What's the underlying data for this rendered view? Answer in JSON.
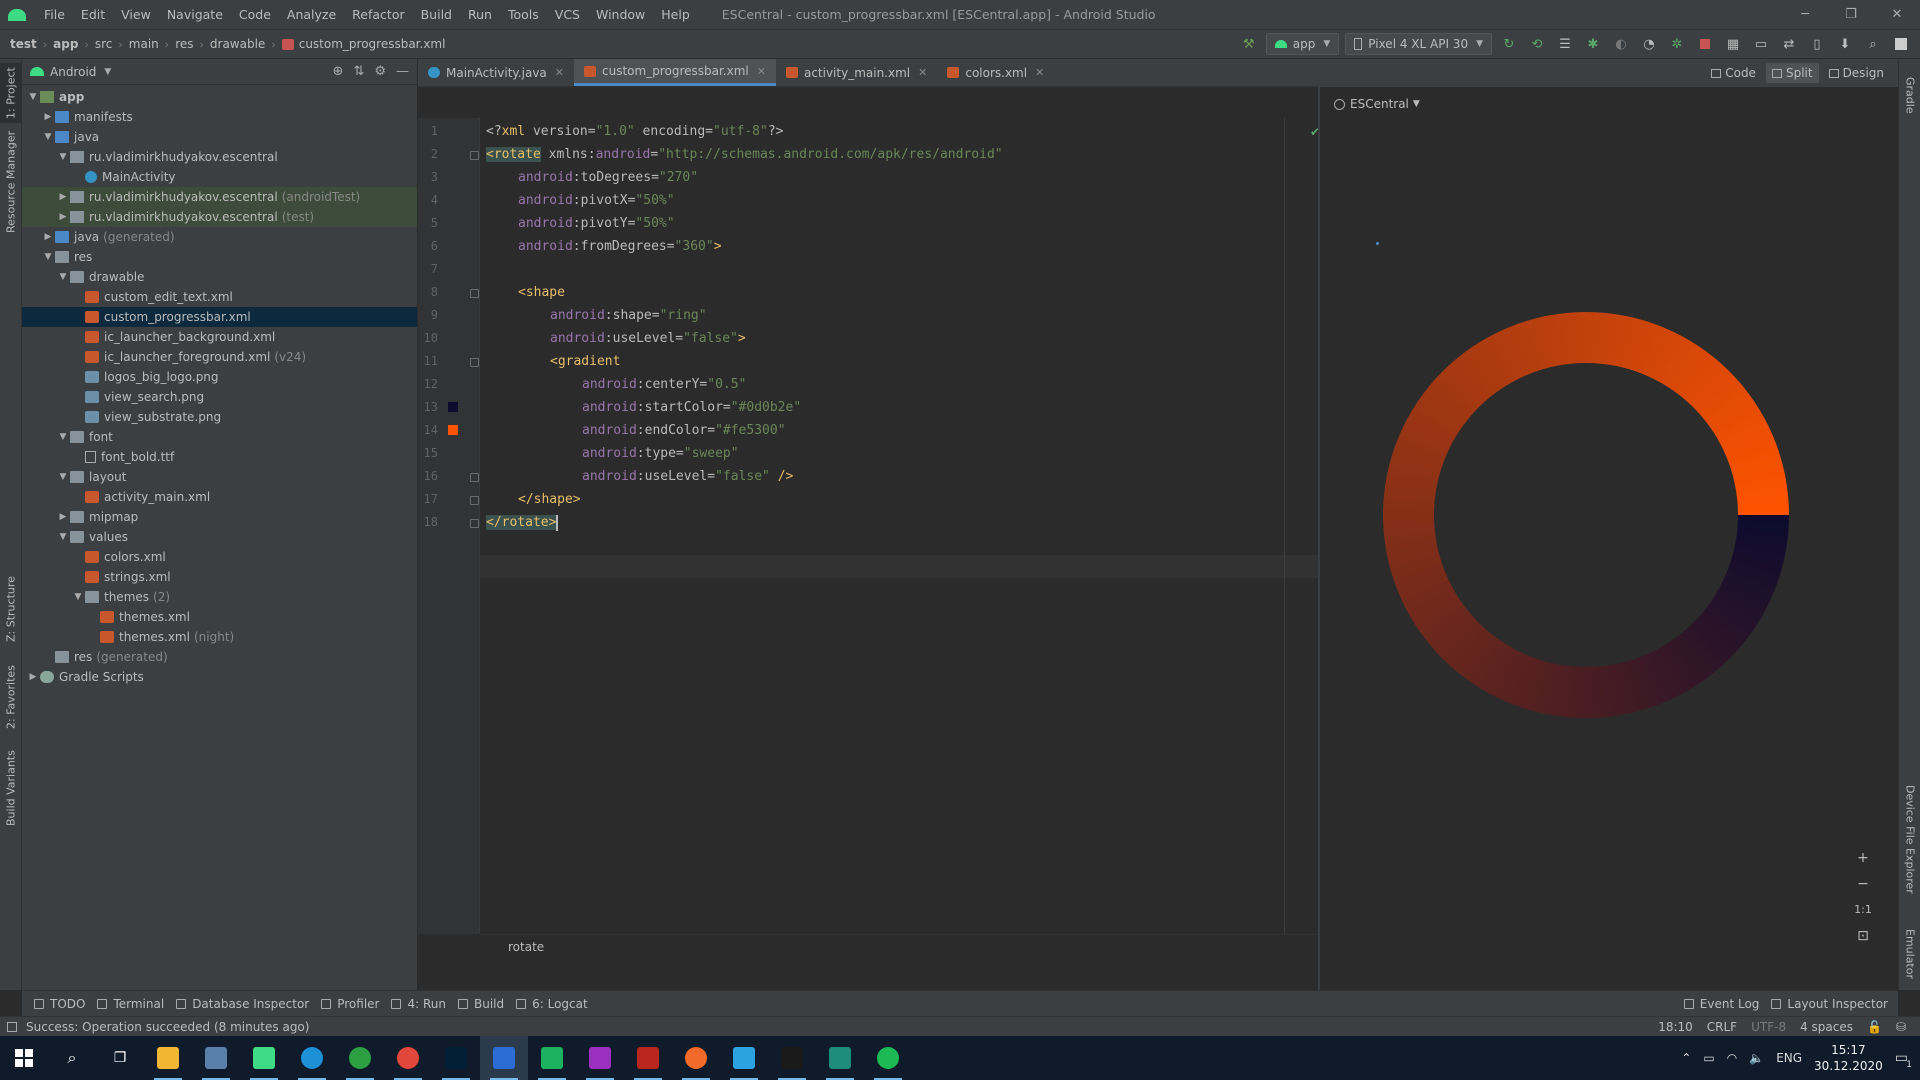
{
  "window": {
    "title": "ESCentral - custom_progressbar.xml [ESCentral.app] - Android Studio",
    "menu": [
      "File",
      "Edit",
      "View",
      "Navigate",
      "Code",
      "Analyze",
      "Refactor",
      "Build",
      "Run",
      "Tools",
      "VCS",
      "Window",
      "Help"
    ]
  },
  "breadcrumbs": [
    "test",
    "app",
    "src",
    "main",
    "res",
    "drawable",
    "custom_progressbar.xml"
  ],
  "toolbar": {
    "config": "app",
    "device": "Pixel 4 XL API 30"
  },
  "left_strip": {
    "project": "1: Project",
    "resource_manager": "Resource Manager",
    "structure": "Z: Structure",
    "favorites": "2: Favorites",
    "build_variants": "Build Variants"
  },
  "right_strip": {
    "gradle": "Gradle",
    "device_file_explorer": "Device File Explorer",
    "emulator": "Emulator"
  },
  "project_panel": {
    "view": "Android",
    "tree": [
      {
        "label": "app",
        "depth": 0,
        "icon": "app",
        "open": true,
        "bold": true
      },
      {
        "label": "manifests",
        "depth": 1,
        "icon": "folderb",
        "open": false
      },
      {
        "label": "java",
        "depth": 1,
        "icon": "folderb",
        "open": true
      },
      {
        "label": "ru.vladimirkhudyakov.escentral",
        "depth": 2,
        "icon": "pkg",
        "open": true
      },
      {
        "label": "MainActivity",
        "depth": 3,
        "icon": "cls"
      },
      {
        "label": "ru.vladimirkhudyakov.escentral",
        "sub": "(androidTest)",
        "depth": 2,
        "icon": "pkg",
        "open": false,
        "hl": true
      },
      {
        "label": "ru.vladimirkhudyakov.escentral",
        "sub": "(test)",
        "depth": 2,
        "icon": "pkg",
        "open": false,
        "hl": true
      },
      {
        "label": "java",
        "sub": "(generated)",
        "depth": 1,
        "icon": "folderb",
        "open": false
      },
      {
        "label": "res",
        "depth": 1,
        "icon": "folder",
        "open": true
      },
      {
        "label": "drawable",
        "depth": 2,
        "icon": "folder",
        "open": true
      },
      {
        "label": "custom_edit_text.xml",
        "depth": 3,
        "icon": "xml"
      },
      {
        "label": "custom_progressbar.xml",
        "depth": 3,
        "icon": "xml",
        "sel": true
      },
      {
        "label": "ic_launcher_background.xml",
        "depth": 3,
        "icon": "xml"
      },
      {
        "label": "ic_launcher_foreground.xml",
        "sub": "(v24)",
        "depth": 3,
        "icon": "xml"
      },
      {
        "label": "logos_big_logo.png",
        "depth": 3,
        "icon": "png"
      },
      {
        "label": "view_search.png",
        "depth": 3,
        "icon": "png"
      },
      {
        "label": "view_substrate.png",
        "depth": 3,
        "icon": "png"
      },
      {
        "label": "font",
        "depth": 2,
        "icon": "folder",
        "open": true
      },
      {
        "label": "font_bold.ttf",
        "depth": 3,
        "icon": "ttf"
      },
      {
        "label": "layout",
        "depth": 2,
        "icon": "folder",
        "open": true
      },
      {
        "label": "activity_main.xml",
        "depth": 3,
        "icon": "xml"
      },
      {
        "label": "mipmap",
        "depth": 2,
        "icon": "folder",
        "open": false
      },
      {
        "label": "values",
        "depth": 2,
        "icon": "folder",
        "open": true
      },
      {
        "label": "colors.xml",
        "depth": 3,
        "icon": "xml"
      },
      {
        "label": "strings.xml",
        "depth": 3,
        "icon": "xml"
      },
      {
        "label": "themes",
        "sub": "(2)",
        "depth": 3,
        "icon": "folder",
        "open": true
      },
      {
        "label": "themes.xml",
        "depth": 4,
        "icon": "xml"
      },
      {
        "label": "themes.xml",
        "sub": "(night)",
        "depth": 4,
        "icon": "xml"
      },
      {
        "label": "res",
        "sub": "(generated)",
        "depth": 1,
        "icon": "folder"
      },
      {
        "label": "Gradle Scripts",
        "depth": 0,
        "icon": "gradle",
        "open": false
      }
    ]
  },
  "editor": {
    "tabs": [
      {
        "label": "MainActivity.java",
        "icon_color": "#3592c4",
        "active": false
      },
      {
        "label": "custom_progressbar.xml",
        "icon_color": "#c9572e",
        "active": true
      },
      {
        "label": "activity_main.xml",
        "icon_color": "#c9572e",
        "active": false
      },
      {
        "label": "colors.xml",
        "icon_color": "#c9572e",
        "active": false
      }
    ],
    "line_numbers": [
      "1",
      "2",
      "3",
      "4",
      "5",
      "6",
      "7",
      "8",
      "9",
      "10",
      "11",
      "12",
      "13",
      "14",
      "15",
      "16",
      "17",
      "18"
    ],
    "breadcrumb": "rotate",
    "color_marks": [
      "#0d0b2e",
      "#fe5300"
    ]
  },
  "code": {
    "l1": {
      "a": "<?",
      "b": "xml ",
      "c": "version=",
      "d": "\"1.0\"",
      "e": " encoding=",
      "f": "\"utf-8\"",
      "g": "?>"
    },
    "l2": {
      "a": "<rotate",
      "b": " xmlns:",
      "c": "android",
      "d": "=",
      "e": "\"http://schemas.android.com/apk/res/android\""
    },
    "l3": {
      "ns": "android",
      "at": ":toDegrees=",
      "av": "\"270\""
    },
    "l4": {
      "ns": "android",
      "at": ":pivotX=",
      "av": "\"50%\""
    },
    "l5": {
      "ns": "android",
      "at": ":pivotY=",
      "av": "\"50%\""
    },
    "l6": {
      "ns": "android",
      "at": ":fromDegrees=",
      "av": "\"360\"",
      "end": ">"
    },
    "l8": {
      "tg": "<shape"
    },
    "l9": {
      "ns": "android",
      "at": ":shape=",
      "av": "\"ring\""
    },
    "l10": {
      "ns": "android",
      "at": ":useLevel=",
      "av": "\"false\"",
      "end": ">"
    },
    "l11": {
      "tg": "<gradient"
    },
    "l12": {
      "ns": "android",
      "at": ":centerY=",
      "av": "\"0.5\""
    },
    "l13": {
      "ns": "android",
      "at": ":startColor=",
      "av": "\"#0d0b2e\""
    },
    "l14": {
      "ns": "android",
      "at": ":endColor=",
      "av": "\"#fe5300\""
    },
    "l15": {
      "ns": "android",
      "at": ":type=",
      "av": "\"sweep\""
    },
    "l16": {
      "ns": "android",
      "at": ":useLevel=",
      "av": "\"false\"",
      "end": " />"
    },
    "l17": {
      "tg": "</shape>"
    },
    "l18": {
      "tg": "</rotate>"
    }
  },
  "preview": {
    "modes": [
      "Code",
      "Split",
      "Design"
    ],
    "active_mode": "Split",
    "theme": "ESCentral",
    "ring": {
      "start_color": "#0d0b2e",
      "end_color": "#fe5300",
      "type": "sweep"
    },
    "zoom_controls": [
      "+",
      "−",
      "1:1"
    ]
  },
  "tool_windows": {
    "left": [
      "TODO",
      "Terminal",
      "Database Inspector",
      "Profiler",
      "4: Run",
      "Build",
      "6: Logcat"
    ],
    "right": [
      "Event Log",
      "Layout Inspector"
    ]
  },
  "status": {
    "message": "Success: Operation succeeded (8 minutes ago)",
    "position": "18:10",
    "line_sep": "CRLF",
    "encoding": "UTF-8",
    "indent": "4 spaces"
  },
  "taskbar": {
    "apps": [
      {
        "name": "explorer",
        "color": "#f2b632"
      },
      {
        "name": "app-2",
        "color": "#5a7fa8"
      },
      {
        "name": "android-studio",
        "color": "#3ddc84"
      },
      {
        "name": "app-4",
        "color": "#1e90d6"
      },
      {
        "name": "app-5",
        "color": "#2da043"
      },
      {
        "name": "chrome",
        "color": "#e2473b"
      },
      {
        "name": "photoshop",
        "color": "#001e36"
      },
      {
        "name": "app-8",
        "color": "#2b6cd6"
      },
      {
        "name": "app-9",
        "color": "#1bb15f"
      },
      {
        "name": "app-10",
        "color": "#9b2fbf"
      },
      {
        "name": "filezilla",
        "color": "#b8261c"
      },
      {
        "name": "app-12",
        "color": "#f16a2a"
      },
      {
        "name": "telegram",
        "color": "#2aa3e0"
      },
      {
        "name": "intellij",
        "color": "#1a1a1a"
      },
      {
        "name": "app-15",
        "color": "#1f8c7a"
      },
      {
        "name": "spotify",
        "color": "#1db954"
      }
    ],
    "lang": "ENG",
    "time": "15:17",
    "date": "30.12.2020",
    "notifications": "1"
  }
}
